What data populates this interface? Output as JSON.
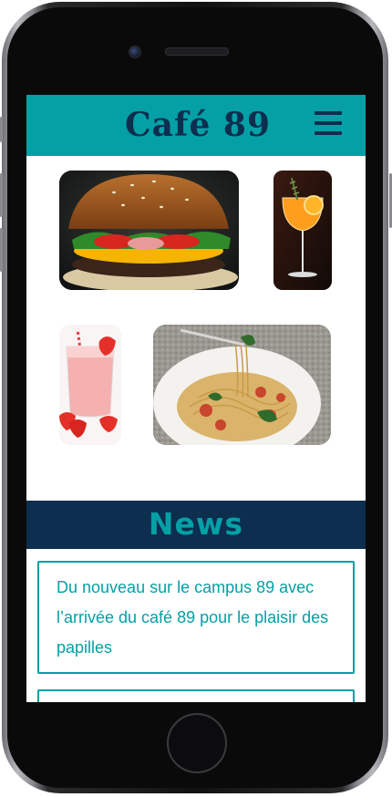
{
  "brand": {
    "logo_text": "Café 89",
    "primary_color": "#04a0a6",
    "dark_color": "#0d2e4f"
  },
  "header": {
    "menu_icon": "hamburger-menu-icon"
  },
  "gallery": [
    {
      "name": "burger"
    },
    {
      "name": "cocktail"
    },
    {
      "name": "smoothie"
    },
    {
      "name": "pasta"
    }
  ],
  "news": {
    "title": "News",
    "items": [
      {
        "text": "Du nouveau sur le campus 89 avec l’arrivée du café 89 pour le plaisir des papilles"
      }
    ]
  }
}
